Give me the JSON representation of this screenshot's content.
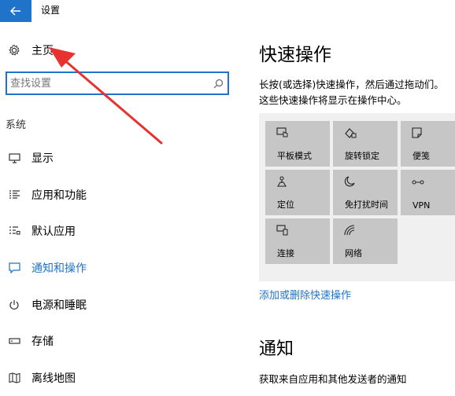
{
  "window": {
    "title": "设置"
  },
  "sidebar": {
    "home_label": "主页",
    "search_placeholder": "查找设置",
    "section_label": "系统",
    "items": [
      {
        "label": "显示",
        "icon": "monitor-icon"
      },
      {
        "label": "应用和功能",
        "icon": "app-list-icon"
      },
      {
        "label": "默认应用",
        "icon": "default-apps-icon"
      },
      {
        "label": "通知和操作",
        "icon": "notification-icon",
        "active": true
      },
      {
        "label": "电源和睡眠",
        "icon": "power-icon"
      },
      {
        "label": "存储",
        "icon": "storage-icon"
      },
      {
        "label": "离线地图",
        "icon": "map-icon"
      }
    ]
  },
  "main": {
    "quick_actions_title": "快速操作",
    "quick_actions_desc": "长按(或选择)快速操作，然后通过拖动们。这些快速操作将显示在操作中心。",
    "tiles": [
      {
        "label": "平板模式",
        "icon": "tablet-mode-icon"
      },
      {
        "label": "旋转锁定",
        "icon": "rotation-lock-icon"
      },
      {
        "label": "便笺",
        "icon": "note-icon"
      },
      {
        "label": "定位",
        "icon": "location-icon"
      },
      {
        "label": "免打扰时间",
        "icon": "moon-icon"
      },
      {
        "label": "VPN",
        "icon": "vpn-icon"
      },
      {
        "label": "连接",
        "icon": "connect-icon"
      },
      {
        "label": "网络",
        "icon": "network-icon"
      }
    ],
    "add_remove_link": "添加或删除快速操作",
    "notifications_title": "通知",
    "notifications_desc": "获取来自应用和其他发送者的通知"
  },
  "colors": {
    "accent": "#1f73c8",
    "tile": "#c6c6c6",
    "annotation_arrow": "#e8322f"
  }
}
